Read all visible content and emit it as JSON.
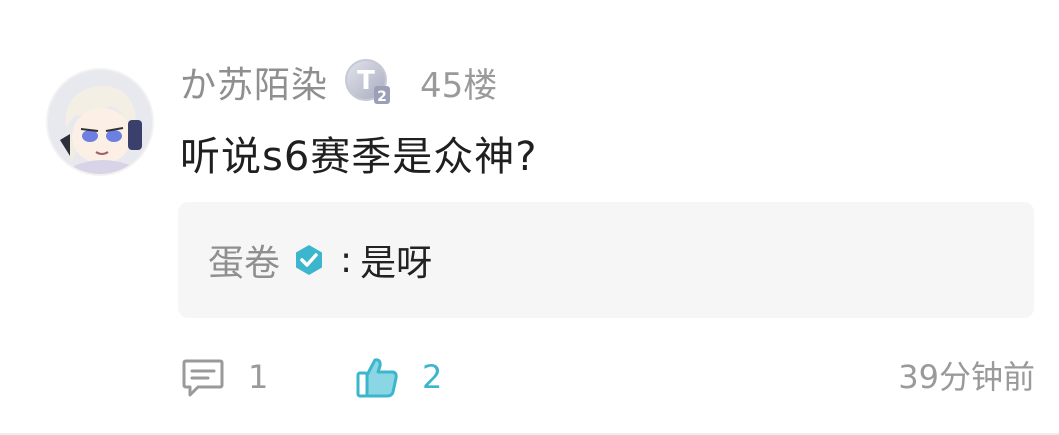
{
  "comment": {
    "username": "か苏陌染",
    "level_badge": "T2",
    "floor": "45楼",
    "text": "听说s6赛季是众神?",
    "reply": {
      "username": "蛋卷",
      "separator": ":",
      "text": "是呀"
    },
    "actions": {
      "reply_count": "1",
      "like_count": "2"
    },
    "time": "39分钟前"
  },
  "colors": {
    "accent": "#3cb6cc",
    "muted_text": "#9a9a9a",
    "body_text": "#1f1f1f",
    "reply_bg": "#f6f6f6"
  },
  "icons": {
    "badge": "level-badge-icon",
    "verified": "verified-check-icon",
    "reply": "comment-bubble-icon",
    "like": "thumbs-up-icon"
  }
}
